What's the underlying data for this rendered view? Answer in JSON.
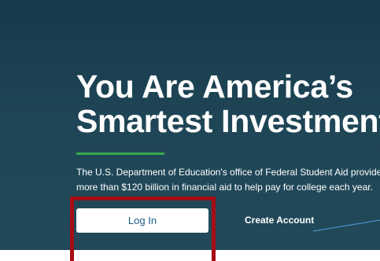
{
  "hero": {
    "headline_line1": "You Are America’s",
    "headline_line2": "Smartest Investment",
    "description_line1": "The U.S. Department of Education's office of Federal Student Aid provides",
    "description_line2": "more than $120 billion in financial aid to help pay for college each year."
  },
  "actions": {
    "login_label": "Log In",
    "create_account_label": "Create Account"
  },
  "colors": {
    "hero_bg": "#1f4656",
    "accent_green": "#3aaa4a",
    "highlight_red": "#a50d15",
    "button_text": "#1c5e84"
  }
}
